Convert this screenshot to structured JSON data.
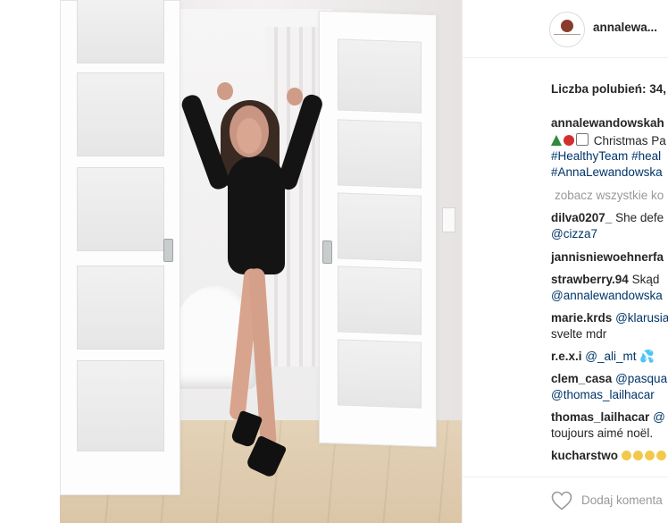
{
  "post": {
    "username": "annalewa...",
    "likes_label": "Liczba polubień: 34,",
    "caption": {
      "user": "annalewandowskah",
      "line2_text": "Christmas Pa",
      "tags_line3": [
        "#HealthyTeam",
        "#heal"
      ],
      "tags_line4": [
        "#AnnaLewandowska"
      ]
    },
    "view_all": "zobacz wszystkie ko",
    "comments": [
      {
        "user": "dilva0207_",
        "text": "She defe"
      },
      {
        "user": "",
        "text": "@cizza7"
      },
      {
        "user": "jannisniewoehnerfa",
        "text": ""
      },
      {
        "user": "strawberry.94",
        "text": "Skąd"
      },
      {
        "user": "",
        "text": "@annalewandowska"
      },
      {
        "user": "marie.krds",
        "text": "@klarusia"
      },
      {
        "user": "",
        "text": "svelte mdr"
      },
      {
        "user": "r.e.x.i",
        "text": "@_ali_mt"
      },
      {
        "user": "clem_casa",
        "text": "@pasqua"
      },
      {
        "user": "",
        "text": "@thomas_lailhacar"
      },
      {
        "user": "thomas_lailhacar",
        "text": "@"
      },
      {
        "user": "",
        "text": "toujours aimé noël."
      },
      {
        "user": "kucharstwo",
        "text": ""
      }
    ],
    "add_comment_placeholder": "Dodaj komenta"
  },
  "icons": {
    "heart": "heart-outline-icon",
    "avatar": "profile-avatar"
  },
  "colors": {
    "text": "#262626",
    "link": "#003569",
    "muted": "#999999",
    "divider": "#efefef"
  }
}
